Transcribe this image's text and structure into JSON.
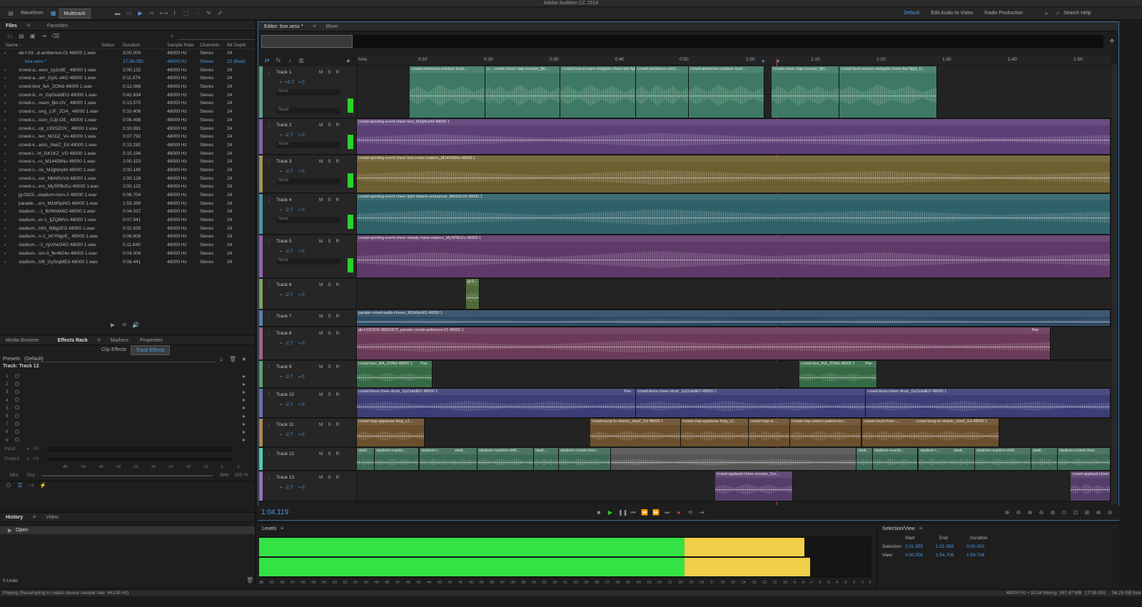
{
  "app": {
    "title": "Adobe Audition CC 2018"
  },
  "toolbar": {
    "waveform": "Waveform",
    "multitrack": "Multitrack",
    "workspaces": [
      "Default",
      "Edit Audio to Video",
      "Radio Production"
    ],
    "search": "Search Help"
  },
  "files": {
    "tab": "Files",
    "tab2": "Favorites",
    "columns": [
      "Name ↑",
      "Status",
      "Duration",
      "Sample Rate",
      "Channels",
      "Bit Depth"
    ],
    "rows": [
      [
        "ab-f-03...d-ambience-01 48000 1.wav",
        "",
        "3:00.000",
        "48000 Hz",
        "Stereo",
        "24"
      ],
      [
        "box.sesx *",
        "",
        "17:38.055",
        "48000 Hz",
        "Stereo",
        "32 (float)"
      ],
      [
        "crowd-a...eers_zy2o9E_ 48000 1.wav",
        "",
        "2:00.132",
        "48000 Hz",
        "Stereo",
        "24"
      ],
      [
        "crowd-a...am_GyrL-d4O 48000 1.wav",
        "",
        "0:11.874",
        "48000 Hz",
        "Stereo",
        "24"
      ],
      [
        "crowd-boo_fkA_ZONd 48000 1.wav",
        "",
        "0:12.066",
        "48000 Hz",
        "Stereo",
        "24"
      ],
      [
        "crowd-b...m_GyOubdEO 48000 1.wav",
        "",
        "0:42.834",
        "48000 Hz",
        "Stereo",
        "24"
      ],
      [
        "crowd-c...ream_fjkt-OV_ 48000 1.wav",
        "",
        "0:13.570",
        "48000 Hz",
        "Stereo",
        "24"
      ],
      [
        "crowd-c...ong_zJF_ZO4_ 48000 1.wav",
        "",
        "0:10.406",
        "48000 Hz",
        "Stereo",
        "24"
      ],
      [
        "crowd-c...ison_GJjI-OE_ 48000 1.wav",
        "",
        "0:06.496",
        "48000 Hz",
        "Stereo",
        "24"
      ],
      [
        "crowd-c...op_zJGSZOV_ 48000 1.wav",
        "",
        "0:10.891",
        "48000 Hz",
        "Stereo",
        "24"
      ],
      [
        "crowd-c...ten_MJ1tZ_Vu 48000 1.wav",
        "",
        "0:07.792",
        "48000 Hz",
        "Stereo",
        "24"
      ],
      [
        "crowd-k...ants_zkeiZ_Ed 48000 1.wav",
        "",
        "0:13.282",
        "48000 Hz",
        "Stereo",
        "24"
      ],
      [
        "crowd-l...ht_GK1KZ_VO 48000 1.wav",
        "",
        "0:15.194",
        "48000 Hz",
        "Stereo",
        "24"
      ],
      [
        "crowd-s...rs_M14459Nu 48000 1.wav",
        "",
        "2:00.153",
        "48000 Hz",
        "Stereo",
        "24"
      ],
      [
        "crowd-s...oo_MJgNrq4d 48000 1.wav",
        "",
        "2:00.140",
        "48000 Hz",
        "Stereo",
        "24"
      ],
      [
        "crowd-s...cer_MkhlScVd 48000 1.wav",
        "",
        "2:00.128",
        "48000 Hz",
        "Stereo",
        "24"
      ],
      [
        "crowd-s...ers_MySPBcEu 48000 1.wav",
        "",
        "2:00.132",
        "48000 Hz",
        "Stereo",
        "24"
      ],
      [
        "jg-0323...stadium-horn-2 48000 1.wav",
        "",
        "0:06.704",
        "48000 Hz",
        "Stereo",
        "24"
      ],
      [
        "parade-...ers_M1bRpiNO 48000 1.wav",
        "",
        "1:59.390",
        "48000 Hz",
        "Stereo",
        "24"
      ],
      [
        "stadium...-1_fk0MxM4O 48000 1.wav",
        "",
        "0:04.037",
        "48000 Hz",
        "Stereo",
        "24"
      ],
      [
        "stadium...er-1_fjZQlMVu 48000 1.wav",
        "",
        "0:07.941",
        "48000 Hz",
        "Stereo",
        "24"
      ],
      [
        "stadium...hhh_fkBgzEO 48000 1.wav",
        "",
        "0:02.635",
        "48000 Hz",
        "Stereo",
        "24"
      ],
      [
        "stadium...n-1_zKYNgzE_ 48000 1.wav",
        "",
        "0:06.806",
        "48000 Hz",
        "Stereo",
        "24"
      ],
      [
        "stadium...-2_zyVXeG4O 48000 1.wav",
        "",
        "0:11.840",
        "48000 Hz",
        "Stereo",
        "24"
      ],
      [
        "stadium...ion-3_fkr4tG4u 48000 1.wav",
        "",
        "0:04.004",
        "48000 Hz",
        "Stereo",
        "24"
      ],
      [
        "stadium...hift_GySrgMEd 48000 1.wav",
        "",
        "0:08.441",
        "48000 Hz",
        "Stereo",
        "24"
      ]
    ]
  },
  "effects": {
    "tabs": [
      "Media Browser",
      "Effects Rack",
      "Markers",
      "Properties"
    ],
    "subtabs": [
      "Clip Effects",
      "Track Effects"
    ],
    "presets_label": "Presets:",
    "preset": "(Default)",
    "track": "Track: Track 12",
    "slots": [
      "1",
      "2",
      "3",
      "4",
      "5",
      "6",
      "7",
      "8",
      "9"
    ],
    "input": "Input",
    "output": "Output",
    "input_val": "+0",
    "output_val": "+0",
    "mix": "Mix:",
    "dry": "Dry",
    "wet": "Wet",
    "wet_val": "100 %",
    "scale": [
      "dB",
      "-54",
      "-48",
      "-42",
      "-36",
      "-30",
      "-24",
      "-18",
      "-12",
      "-6",
      "0"
    ]
  },
  "history": {
    "tabs": [
      "History",
      "Video"
    ],
    "items": [
      "Open"
    ],
    "undo": "0 Undo"
  },
  "editor": {
    "tab": "Editor: box.sesx *",
    "tab2": "Mixer",
    "timecode": "1:04.119",
    "ruler": [
      "hms",
      "0:10",
      "0:20",
      "0:30",
      "0:40",
      "0:50",
      "1:00",
      "1:10",
      "1:20",
      "1:30",
      "1:40",
      "1:50"
    ]
  },
  "tracks": [
    {
      "name": "Track 1",
      "vol": "+2.7",
      "pan": "0",
      "color": "#5fa07e",
      "input": "None",
      "read": "Read",
      "clips": [
        {
          "label": "crowd-ambience-outdoor-loud-...",
          "start": 0.07,
          "end": 0.17,
          "color": "#3e7a63"
        },
        {
          "label": "cr...",
          "start": 0.17,
          "end": 0.18,
          "color": "#3e7a63"
        },
        {
          "label": "crowd-cheer-clap-scream_fjkt-...",
          "start": 0.18,
          "end": 0.27,
          "color": "#3e7a63"
        },
        {
          "label": "crowd-loud-scream-instigate-cheer-bar-fight_...",
          "start": 0.27,
          "end": 0.37,
          "color": "#3e7a63"
        },
        {
          "label": "crowd-ambience-outd...",
          "start": 0.37,
          "end": 0.44,
          "color": "#3e7a63"
        },
        {
          "label": "crowd-ambience-outdoor-loud-...",
          "start": 0.44,
          "end": 0.54,
          "color": "#3e7a63"
        },
        {
          "label": "crowd-cheer-clap-scream_fjkt-...",
          "start": 0.55,
          "end": 0.64,
          "color": "#3e7a63"
        },
        {
          "label": "crowd-loud-scream-instigate-cheer-bar-fight_G...",
          "start": 0.64,
          "end": 0.77,
          "color": "#3e7a63"
        }
      ]
    },
    {
      "name": "Track 2",
      "vol": "-2.7",
      "pan": "0",
      "color": "#8a5fa8",
      "input": "None",
      "clips": [
        {
          "label": "crowd-sporting-event-cheer-boo_MJgNrq4d 48000 1",
          "start": 0,
          "end": 1,
          "color": "#5d3f77"
        }
      ]
    },
    {
      "name": "Track 3",
      "vol": "-2.7",
      "pan": "0",
      "color": "#a8934f",
      "input": "None",
      "clips": [
        {
          "label": "crowd-sporting-event-cheer-boo-noise-makers_M14459Nu 48000 1",
          "start": 0,
          "end": 1,
          "color": "#6e5f31"
        }
      ]
    },
    {
      "name": "Track 4",
      "vol": "-2.7",
      "pan": "0",
      "color": "#4d95a0",
      "input": "None",
      "clips": [
        {
          "label": "crowd-sporting-event-cheer-light-distant-announcer_MkhlScVd 48000 1",
          "start": 0,
          "end": 1,
          "color": "#2f6169"
        }
      ]
    },
    {
      "name": "Track 5",
      "vol": "-2.7",
      "pan": "0",
      "color": "#9a5fa8",
      "input": "None",
      "clips": [
        {
          "label": "crowd-sporting-event-cheer-steady-noise-makers_MySPBcEu 48000 1",
          "start": 0,
          "end": 1,
          "color": "#5f3a69"
        }
      ]
    },
    {
      "name": "Track 6",
      "vol": "-2.7",
      "pan": "0",
      "color": "#7fa05f",
      "clips": [
        {
          "label": "jg-0...",
          "start": 0.145,
          "end": 0.163,
          "color": "#4f6a3a"
        }
      ]
    },
    {
      "name": "Track 7",
      "vol": "",
      "pan": "",
      "color": "#5f7fa8",
      "clips": [
        {
          "label": "parade-crowd-walla-cheers_M1bRpiNO 48000 1",
          "start": 0,
          "end": 1,
          "color": "#2e4a63"
        }
      ]
    },
    {
      "name": "Track 8",
      "vol": "-2.7",
      "pan": "0",
      "color": "#a85f8a",
      "badge": "Pan",
      "clips": [
        {
          "label": "ab-f-031616-38502875_parade-crowd-ambience-01 48000 1",
          "start": 0,
          "end": 0.92,
          "color": "#6b3a58"
        }
      ]
    },
    {
      "name": "Track 9",
      "vol": "-2.7",
      "pan": "0",
      "color": "#5fa06f",
      "clips": [
        {
          "label": "crowd-boo_fkA_ZONd 48000 1",
          "start": 0,
          "end": 0.1,
          "color": "#356a45",
          "badge": "Pan"
        },
        {
          "label": "crowd-boo_fkA_ZONd 48000 1",
          "start": 0.587,
          "end": 0.69,
          "color": "#356a45",
          "badge": "Pan"
        }
      ]
    },
    {
      "name": "Track 10",
      "vol": "-2.7",
      "pan": "0",
      "color": "#6f6fb0",
      "clips": [
        {
          "label": "crowd-boos-cheer-drum_GyOubdEO 48000 1",
          "start": 0,
          "end": 0.37,
          "color": "#3d3d77",
          "badge": "Pan"
        },
        {
          "label": "crowd-boos-cheer-drum_GyOubdEO 48000 1",
          "start": 0.37,
          "end": 0.675,
          "color": "#3d3d77"
        },
        {
          "label": "crowd-boos-cheer-drum_GyOubdEO 48000 1",
          "start": 0.675,
          "end": 1,
          "color": "#3d3d77"
        }
      ]
    },
    {
      "name": "Track 11",
      "vol": "-2.7",
      "pan": "0",
      "color": "#b0874f",
      "clips": [
        {
          "label": "crowd-clap-applause-long_zJ...",
          "start": 0,
          "end": 0.09,
          "color": "#6b4f2c"
        },
        {
          "label": "crowd-kung-fu-chants_zkeiZ_Ed 48000 1",
          "start": 0.31,
          "end": 0.43,
          "color": "#6b4f2c"
        },
        {
          "label": "crowd-clap-applause-long_zJ...",
          "start": 0.43,
          "end": 0.52,
          "color": "#6b4f2c"
        },
        {
          "label": "crowd-clap-st...",
          "start": 0.52,
          "end": 0.575,
          "color": "#6b4f2c"
        },
        {
          "label": "crowd-clap-unison-pattern-loo...",
          "start": 0.575,
          "end": 0.67,
          "color": "#6b4f2c"
        },
        {
          "label": "crowd-count-from-...",
          "start": 0.67,
          "end": 0.74,
          "color": "#6b4f2c"
        },
        {
          "label": "crowd-kung-fu-chants_zkeiZ_Ed 48000 1",
          "start": 0.74,
          "end": 0.853,
          "color": "#6b4f2c"
        }
      ]
    },
    {
      "name": "Track 12",
      "vol": "",
      "pan": "",
      "color": "#4fd0a8",
      "clips": [
        {
          "label": "stadi...",
          "start": 0,
          "end": 0.024,
          "color": "#3d6a55"
        },
        {
          "label": "stadium-reactio...",
          "start": 0.024,
          "end": 0.083,
          "color": "#3d6a55"
        },
        {
          "label": "stadium-r...",
          "start": 0.083,
          "end": 0.128,
          "color": "#3d6a55"
        },
        {
          "label": "stadi...",
          "start": 0.128,
          "end": 0.16,
          "color": "#3d6a55"
        },
        {
          "label": "stadium-reaction-shift...",
          "start": 0.16,
          "end": 0.235,
          "color": "#3d6a55"
        },
        {
          "label": "stadi...",
          "start": 0.235,
          "end": 0.268,
          "color": "#3d6a55"
        },
        {
          "label": "stadium-crowd-chee...",
          "start": 0.268,
          "end": 0.337,
          "color": "#3d6a55"
        },
        {
          "label": "",
          "start": 0.337,
          "end": 0.663,
          "color": "#555555"
        },
        {
          "label": "stadi...",
          "start": 0.663,
          "end": 0.685,
          "color": "#3d6a55"
        },
        {
          "label": "stadium-reactio...",
          "start": 0.685,
          "end": 0.745,
          "color": "#3d6a55"
        },
        {
          "label": "stadium-r...",
          "start": 0.745,
          "end": 0.79,
          "color": "#3d6a55"
        },
        {
          "label": "stadi...",
          "start": 0.79,
          "end": 0.82,
          "color": "#3d6a55"
        },
        {
          "label": "stadium-reaction-shift...",
          "start": 0.82,
          "end": 0.895,
          "color": "#3d6a55"
        },
        {
          "label": "stadi...",
          "start": 0.895,
          "end": 0.93,
          "color": "#3d6a55"
        },
        {
          "label": "stadium-crowd-chee...",
          "start": 0.93,
          "end": 1,
          "color": "#3d6a55"
        }
      ]
    },
    {
      "name": "Track 13",
      "vol": "-2.7",
      "pan": "0",
      "color": "#9a6fb0",
      "clips": [
        {
          "label": "crowd-applaud-cheer-scream_Gyr...",
          "start": 0.475,
          "end": 0.578,
          "color": "#553d6b"
        },
        {
          "label": "crowd-applaud-cheer",
          "start": 0.947,
          "end": 1,
          "color": "#553d6b"
        }
      ]
    }
  ],
  "levels": {
    "title": "Levels",
    "scale": [
      "dB",
      "-59",
      "-58",
      "-57",
      "-56",
      "-55",
      "-54",
      "-53",
      "-52",
      "-51",
      "-50",
      "-49",
      "-48",
      "-47",
      "-46",
      "-45",
      "-44",
      "-43",
      "-42",
      "-41",
      "-40",
      "-39",
      "-38",
      "-37",
      "-36",
      "-35",
      "-34",
      "-33",
      "-32",
      "-31",
      "-30",
      "-29",
      "-28",
      "-27",
      "-26",
      "-25",
      "-24",
      "-23",
      "-22",
      "-21",
      "-20",
      "-19",
      "-18",
      "-17",
      "-16",
      "-15",
      "-14",
      "-13",
      "-12",
      "-11",
      "-10",
      "-9",
      "-8",
      "-7",
      "-6",
      "-5",
      "-4",
      "-3",
      "-2",
      "-1",
      "0"
    ],
    "left": 0.89,
    "right": 0.9
  },
  "selview": {
    "title": "Selection/View",
    "headers": [
      "Start",
      "End",
      "Duration"
    ],
    "selection": {
      "label": "Selection",
      "start": "1:01.955",
      "end": "1:01.955",
      "duration": "0:00.000"
    },
    "view": {
      "label": "View",
      "start": "0:00.000",
      "end": "1:54.706",
      "duration": "1:54.706"
    }
  },
  "status": {
    "left": "Playing (Resampling to match device sample rate: 44100 Hz)",
    "rate": "48000 Hz • 32-bit Mixing",
    "mem": "387.47 MB",
    "dur": "17:38.055",
    "free": "56.29 GB free"
  }
}
